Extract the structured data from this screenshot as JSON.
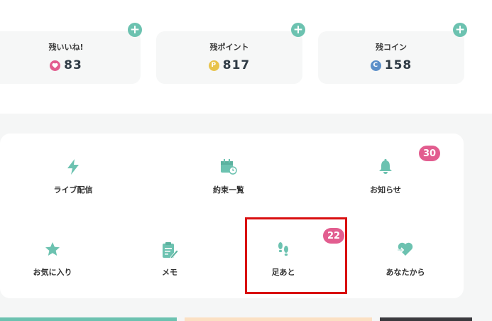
{
  "balances": {
    "likes": {
      "title": "残いいね!",
      "value": "83",
      "icon": "heart-coin-icon",
      "color": "#e25d8f"
    },
    "points": {
      "title": "残ポイント",
      "value": "817",
      "icon": "point-coin-icon",
      "icon_letter": "P",
      "color": "#e8c34a"
    },
    "coins": {
      "title": "残コイン",
      "value": "158",
      "icon": "c-coin-icon",
      "icon_letter": "C",
      "color": "#5b8fc9"
    }
  },
  "menu": {
    "live": {
      "label": "ライブ配信",
      "icon": "bolt-icon"
    },
    "promise": {
      "label": "約束一覧",
      "icon": "calendar-clock-icon"
    },
    "notice": {
      "label": "お知らせ",
      "icon": "bell-icon",
      "badge": "30"
    },
    "favorite": {
      "label": "お気に入り",
      "icon": "star-icon"
    },
    "memo": {
      "label": "メモ",
      "icon": "clipboard-pencil-icon"
    },
    "footprint": {
      "label": "足あと",
      "icon": "footprints-icon",
      "badge": "22"
    },
    "from_you": {
      "label": "あなたから",
      "icon": "heart-arrow-icon"
    }
  },
  "colors": {
    "accent": "#6cc2b0",
    "badge": "#e25d8f",
    "highlight": "#d90f10"
  }
}
